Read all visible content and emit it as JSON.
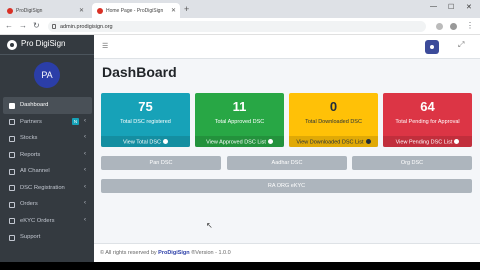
{
  "browser": {
    "tabs": [
      {
        "title": "ProDigiSign",
        "active": false
      },
      {
        "title": "Home Page - ProDigiSign",
        "active": true
      }
    ],
    "url": "admin.prodigisign.org"
  },
  "sidebar": {
    "brand": "Pro DigiSign",
    "avatar_initials": "PA",
    "items": [
      {
        "label": "Dashboard",
        "icon": "dashboard-icon",
        "active": true
      },
      {
        "label": "Partners",
        "icon": "users-icon",
        "badge": "N"
      },
      {
        "label": "Stocks",
        "icon": "box-icon"
      },
      {
        "label": "Reports",
        "icon": "file-icon"
      },
      {
        "label": "All Channel",
        "icon": "list-icon"
      },
      {
        "label": "DSC Registration",
        "icon": "form-icon"
      },
      {
        "label": "Orders",
        "icon": "cart-icon"
      },
      {
        "label": "eKYC Orders",
        "icon": "id-card-icon"
      },
      {
        "label": "Support",
        "icon": "help-icon"
      }
    ]
  },
  "main": {
    "title": "DashBoard",
    "cards": [
      {
        "value": "75",
        "label": "Total DSC registered",
        "link": "View Total DSC",
        "color": "#17a2b8"
      },
      {
        "value": "11",
        "label": "Total Approved DSC",
        "link": "View Approved DSC List",
        "color": "#28a745"
      },
      {
        "value": "0",
        "label": "Total Downloaded DSC",
        "link": "View Downloaded DSC List",
        "color": "#ffc107"
      },
      {
        "value": "64",
        "label": "Total Pending for Approval",
        "link": "View Pending DSC List",
        "color": "#dc3545"
      }
    ],
    "buttons": [
      "Pan DSC",
      "Aadhar DSC",
      "Org DSC"
    ],
    "wide_button": "RA ORG eKYC"
  },
  "footer": {
    "prefix": "© All rights reserved by",
    "brand": "ProDigiSign",
    "suffix": "®Version - 1.0.0"
  }
}
